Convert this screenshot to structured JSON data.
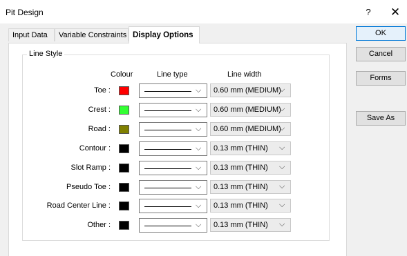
{
  "window": {
    "title": "Pit Design",
    "help_label": "?",
    "close_label": "✕"
  },
  "tabs": [
    {
      "label": "Input Data",
      "active": false
    },
    {
      "label": "Variable Constraints",
      "active": false
    },
    {
      "label": "Display Options",
      "active": true
    }
  ],
  "group": {
    "label": "Line Style",
    "headers": {
      "colour": "Colour",
      "line_type": "Line type",
      "line_width": "Line width"
    },
    "rows": [
      {
        "label": "Toe :",
        "colour": "#ff0000",
        "line_width": "0.60 mm (MEDIUM)"
      },
      {
        "label": "Crest :",
        "colour": "#33ff33",
        "line_width": "0.60 mm (MEDIUM)"
      },
      {
        "label": "Road :",
        "colour": "#808000",
        "line_width": "0.60 mm (MEDIUM)"
      },
      {
        "label": "Contour :",
        "colour": "#000000",
        "line_width": "0.13 mm (THIN)"
      },
      {
        "label": "Slot Ramp :",
        "colour": "#000000",
        "line_width": "0.13 mm (THIN)"
      },
      {
        "label": "Pseudo Toe :",
        "colour": "#000000",
        "line_width": "0.13 mm (THIN)"
      },
      {
        "label": "Road Center Line :",
        "colour": "#000000",
        "line_width": "0.13 mm (THIN)"
      },
      {
        "label": "Other :",
        "colour": "#000000",
        "line_width": "0.13 mm (THIN)"
      }
    ]
  },
  "buttons": {
    "ok": "OK",
    "cancel": "Cancel",
    "forms": "Forms",
    "save_as": "Save As"
  }
}
